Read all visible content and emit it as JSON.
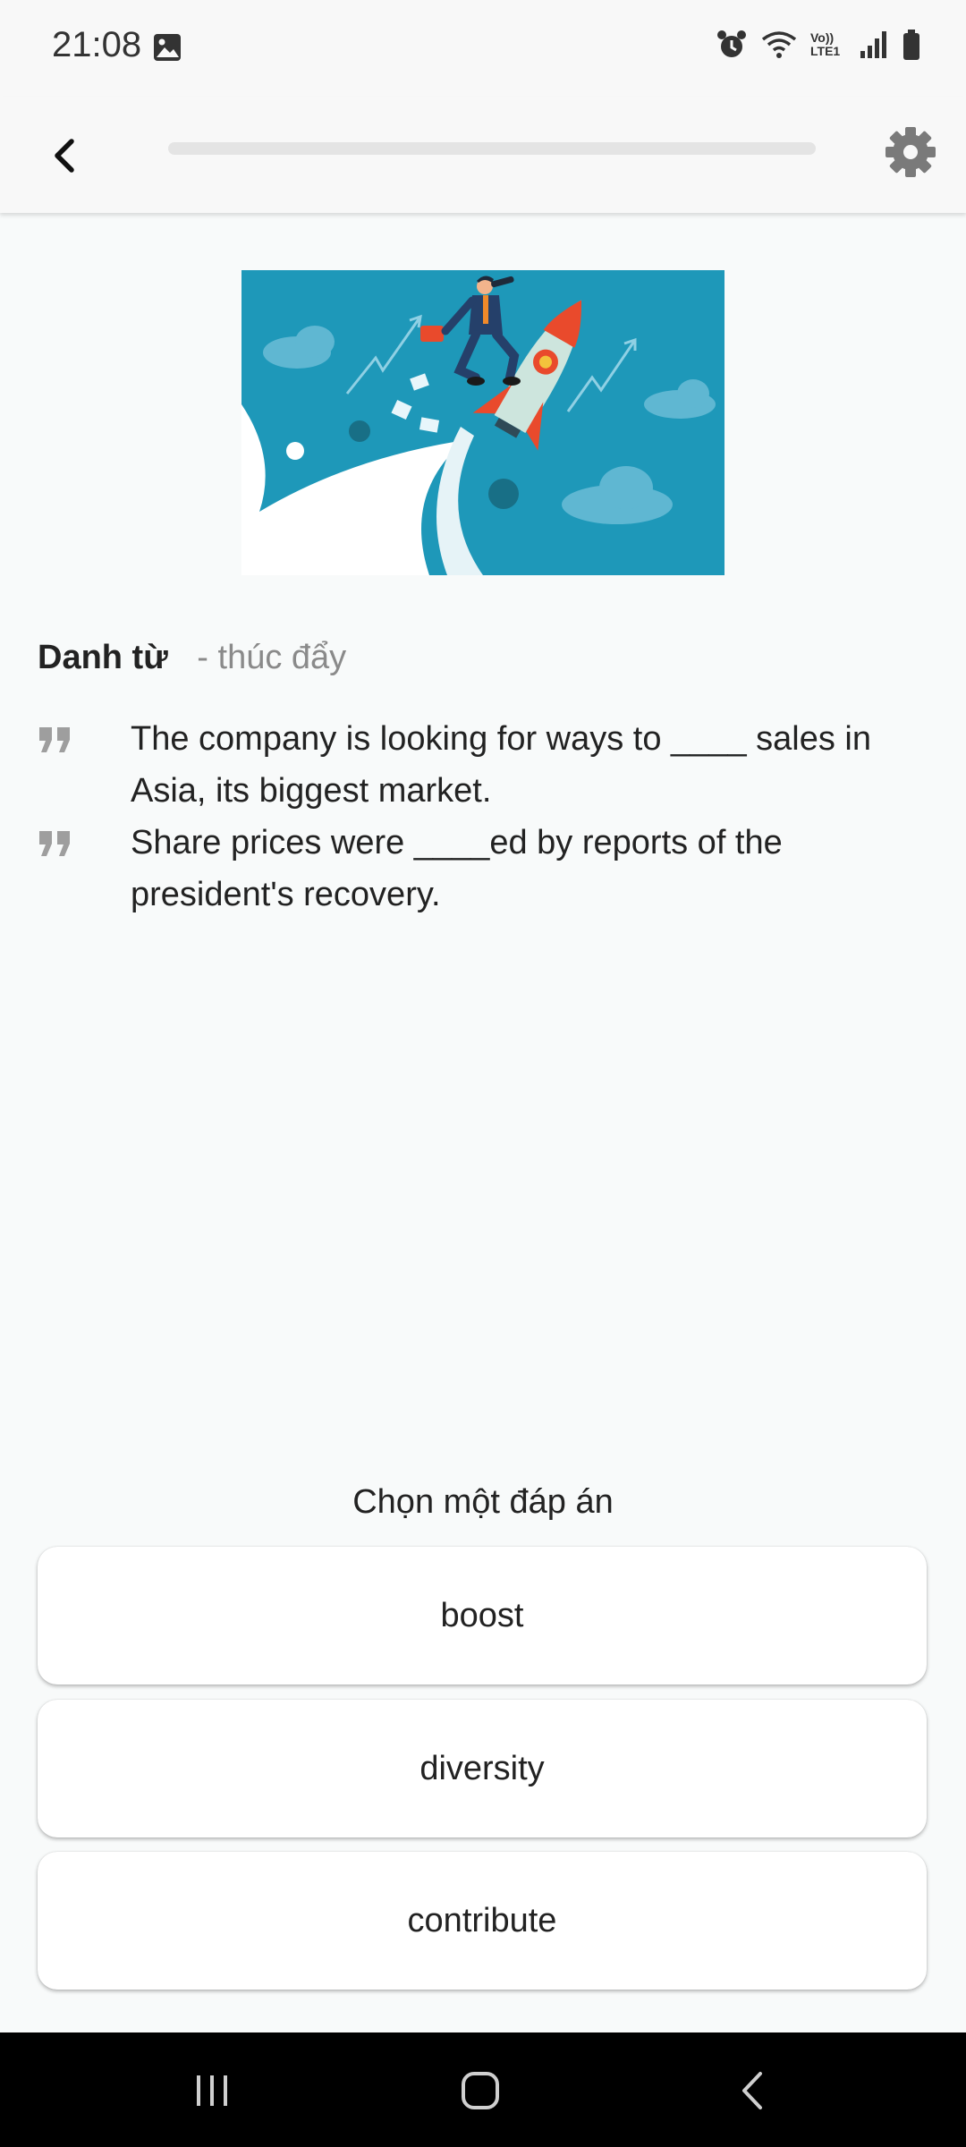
{
  "status_bar": {
    "time": "21:08",
    "network_label": "Vo)) LTE1"
  },
  "header": {
    "progress": 0.0,
    "back_icon": "chevron-left-icon",
    "settings_icon": "gear-icon"
  },
  "word": {
    "type": "Danh từ",
    "meaning": "- thúc đẩy"
  },
  "examples": [
    "The company is looking for ways to ____ sales in Asia, its biggest market.",
    "Share prices were ____ed by reports of the president's recovery."
  ],
  "prompt": "Chọn một đáp án",
  "options": [
    "boost",
    "diversity",
    "contribute"
  ],
  "colors": {
    "illustration_bg": "#1e98b9",
    "rocket": "#e94a2c",
    "quote_icon": "#9e9e9e"
  }
}
